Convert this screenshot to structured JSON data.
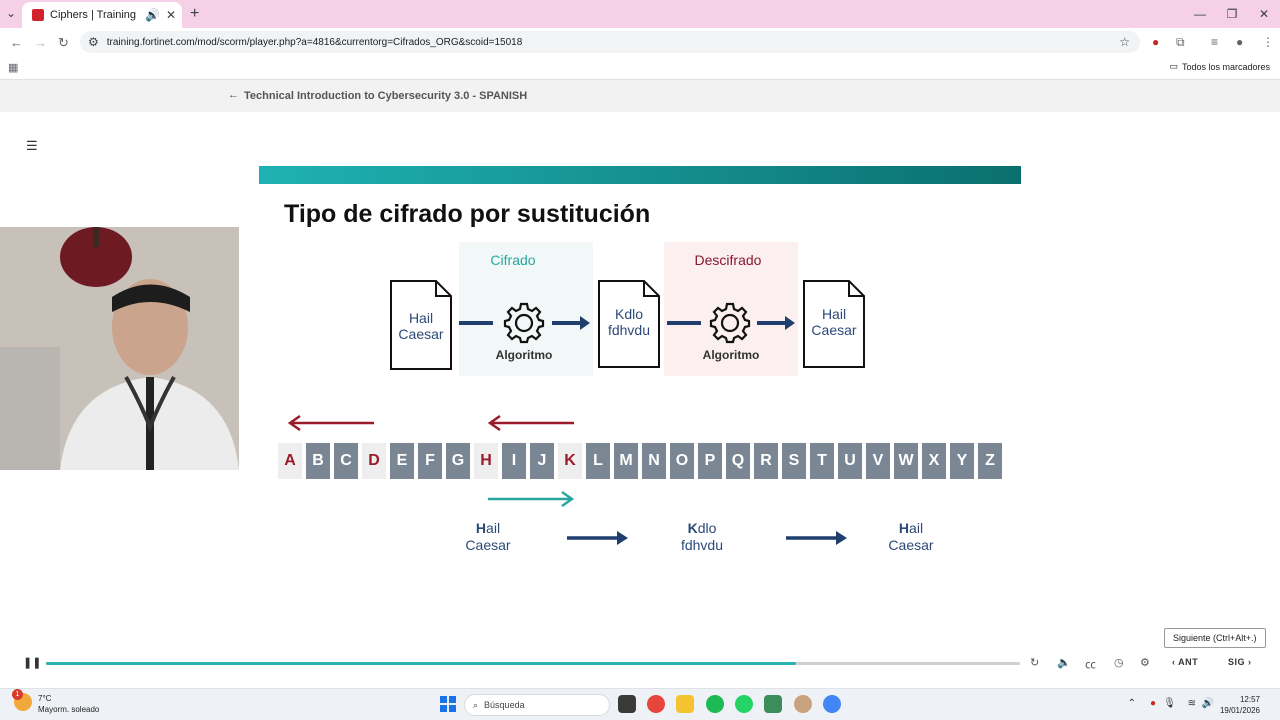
{
  "browser": {
    "tab_title": "Ciphers | Training Institute",
    "url": "training.fortinet.com/mod/scorm/player.php?a=4816&currentorg=Cifrados_ORG&scoid=15018",
    "bookmarks_label": "Todos los marcadores"
  },
  "course": {
    "title": "Technical Introduction to Cybersecurity 3.0 - SPANISH"
  },
  "slide": {
    "title": "Tipo de cifrado por sustitución",
    "encrypt_label": "Cifrado",
    "decrypt_label": "Descifrado",
    "algorithm_label": "Algoritmo",
    "doc1": [
      "Hail",
      "Caesar"
    ],
    "doc2": [
      "Kdlo",
      "fdhvdu"
    ],
    "doc3": [
      "Hail",
      "Caesar"
    ],
    "alphabet": [
      "A",
      "B",
      "C",
      "D",
      "E",
      "F",
      "G",
      "H",
      "I",
      "J",
      "K",
      "L",
      "M",
      "N",
      "O",
      "P",
      "Q",
      "R",
      "S",
      "T",
      "U",
      "V",
      "W",
      "X",
      "Y",
      "Z"
    ],
    "highlighted_letters": [
      "A",
      "D",
      "H",
      "K"
    ],
    "example": {
      "ex1_first": "H",
      "ex1_rest": "ail",
      "ex1_line2": "Caesar",
      "ex2_first": "K",
      "ex2_rest": "dlo",
      "ex2_line2": "fdhvdu",
      "ex3_first": "H",
      "ex3_rest": "ail",
      "ex3_line2": "Caesar"
    },
    "colors": {
      "teal": "#2aa79f",
      "red": "#8a1a2e",
      "navy": "#1f3f6e"
    }
  },
  "player": {
    "tooltip": "Siguiente (Ctrl+Alt+.)",
    "prev_label": "ANT",
    "next_label": "SIG",
    "progress_fraction": 0.77
  },
  "taskbar": {
    "weather_temp": "7°C",
    "weather_desc": "Mayorm. soleado",
    "weather_badge": "1",
    "search_placeholder": "Búsqueda",
    "time": "12:57",
    "date": "19/01/2026"
  }
}
